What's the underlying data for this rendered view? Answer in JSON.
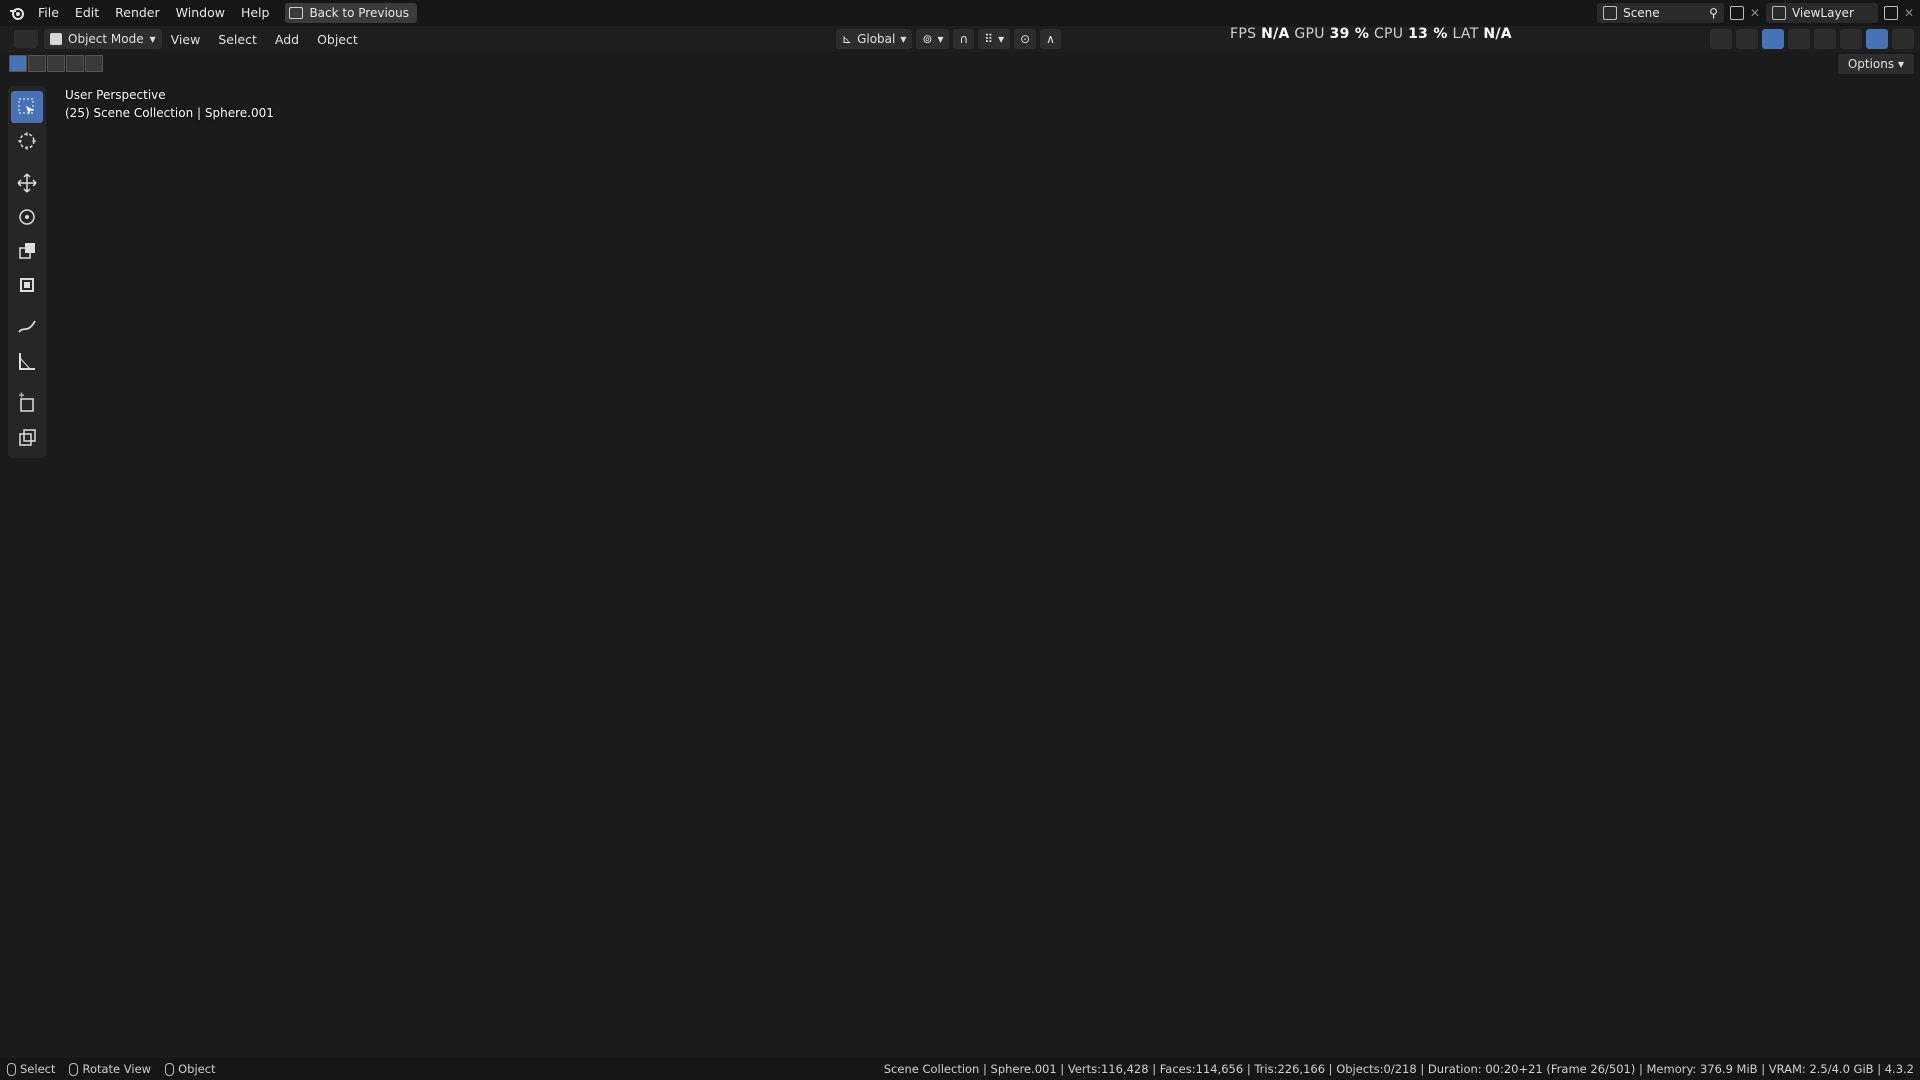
{
  "menu": {
    "items": [
      "File",
      "Edit",
      "Render",
      "Window",
      "Help"
    ],
    "back_label": "Back to Previous"
  },
  "workspace": {
    "scene_label": "Scene",
    "view_layer_label": "ViewLayer"
  },
  "header": {
    "mode_label": "Object Mode",
    "menus": [
      "View",
      "Select",
      "Add",
      "Object"
    ],
    "orientation_label": "Global",
    "options_label": "Options"
  },
  "perf": {
    "fps_label": "FPS",
    "fps_value": "N/A",
    "gpu_label": "GPU",
    "gpu_value": "39 %",
    "cpu_label": "CPU",
    "cpu_value": "13 %",
    "lat_label": "LAT",
    "lat_value": "N/A"
  },
  "viewport": {
    "perspective_label": "User Perspective",
    "collection_label": "(25) Scene Collection | Sphere.001"
  },
  "toolbar": {
    "tools": [
      "select-box",
      "cursor",
      "move",
      "rotate",
      "scale",
      "transform",
      "annotate",
      "measure",
      "add-cube",
      "extrude"
    ]
  },
  "status": {
    "left": [
      "Select",
      "Rotate View",
      "Object"
    ],
    "right": "Scene Collection | Sphere.001 | Verts:116,428 | Faces:114,656 | Tris:226,166 | Objects:0/218 | Duration: 00:20+21 (Frame 26/501) | Memory: 376.9 MiB | VRAM: 2.5/4.0 GiB | 4.3.2"
  },
  "colors": {
    "accent": "#4772b3",
    "wall_pink": "#c9587e",
    "floor_pink": "#f2b8c8",
    "grid_line": "#3a3a3a",
    "x_axis": "#a8323c",
    "y_axis": "#6a8a2a"
  }
}
